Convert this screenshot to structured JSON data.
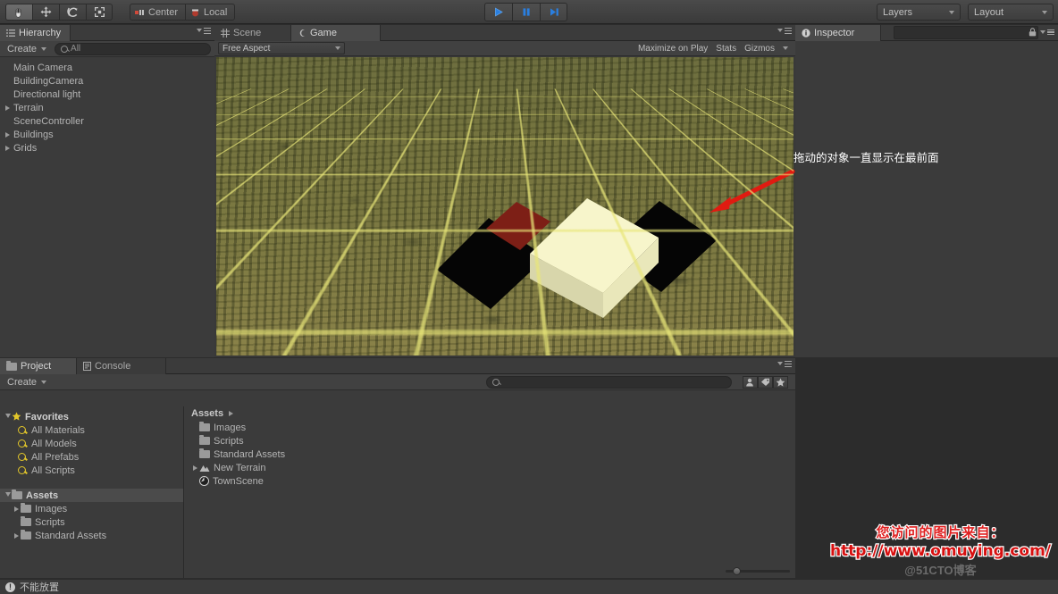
{
  "toolbar": {
    "tools": [
      {
        "name": "hand-tool",
        "icon": "hand-icon",
        "active": true
      },
      {
        "name": "move-tool",
        "icon": "move-icon",
        "active": false
      },
      {
        "name": "rotate-tool",
        "icon": "rotate-icon",
        "active": false
      },
      {
        "name": "scale-tool",
        "icon": "scale-icon",
        "active": false
      }
    ],
    "pivot_label": "Center",
    "rotation_label": "Local",
    "play_buttons": [
      {
        "name": "play-button",
        "icon": "play-icon"
      },
      {
        "name": "pause-button",
        "icon": "pause-icon"
      },
      {
        "name": "step-button",
        "icon": "step-icon"
      }
    ],
    "layers_label": "Layers",
    "layout_label": "Layout"
  },
  "hierarchy": {
    "tab_label": "Hierarchy",
    "create_label": "Create",
    "search_placeholder": "All",
    "search_value": "",
    "items": [
      {
        "label": "Main Camera",
        "expandable": false,
        "indent": 0
      },
      {
        "label": "BuildingCamera",
        "expandable": false,
        "indent": 0
      },
      {
        "label": "Directional light",
        "expandable": false,
        "indent": 0
      },
      {
        "label": "Terrain",
        "expandable": true,
        "indent": 0
      },
      {
        "label": "SceneController",
        "expandable": false,
        "indent": 0
      },
      {
        "label": "Buildings",
        "expandable": true,
        "indent": 0
      },
      {
        "label": "Grids",
        "expandable": true,
        "indent": 0
      }
    ]
  },
  "gameview": {
    "tabs": [
      {
        "label": "Scene",
        "icon": "grid-icon",
        "active": false
      },
      {
        "label": "Game",
        "icon": "gamepad-icon",
        "active": true
      }
    ],
    "aspect_label": "Free Aspect",
    "maximize_label": "Maximize on Play",
    "stats_label": "Stats",
    "gizmos_label": "Gizmos"
  },
  "inspector": {
    "tab_label": "Inspector",
    "search_value": ""
  },
  "project": {
    "tabs": [
      {
        "label": "Project",
        "icon": "folder-icon",
        "active": true
      },
      {
        "label": "Console",
        "icon": "console-icon",
        "active": false
      }
    ],
    "create_label": "Create",
    "search_placeholder": "",
    "search_value": "",
    "filter_icons": [
      "person-filter-icon",
      "tag-filter-icon",
      "favorite-filter-icon"
    ],
    "favorites_label": "Favorites",
    "favorites": [
      {
        "label": "All Materials"
      },
      {
        "label": "All Models"
      },
      {
        "label": "All Prefabs"
      },
      {
        "label": "All Scripts"
      }
    ],
    "assets_label": "Assets",
    "asset_tree": [
      {
        "label": "Images",
        "expandable": true,
        "type": "folder"
      },
      {
        "label": "Scripts",
        "expandable": false,
        "type": "folder"
      },
      {
        "label": "Standard Assets",
        "expandable": true,
        "type": "folder"
      }
    ],
    "breadcrumb": "Assets",
    "contents": [
      {
        "label": "Images",
        "type": "folder",
        "expandable": false
      },
      {
        "label": "Scripts",
        "type": "folder",
        "expandable": false
      },
      {
        "label": "Standard Assets",
        "type": "folder",
        "expandable": false
      },
      {
        "label": "New Terrain",
        "type": "terrain",
        "expandable": true
      },
      {
        "label": "TownScene",
        "type": "scene",
        "expandable": false
      }
    ]
  },
  "statusbar": {
    "message": "不能放置"
  },
  "annotations": {
    "note_text": "拖动的对象一直显示在最前面",
    "arrow_color": "#e01b11",
    "watermark_line1": "您访问的图片来自：",
    "watermark_line2": "http://www.omuying.com/",
    "watermark_line3": "@51CTO博客"
  },
  "scene": {
    "objects": [
      {
        "name": "black-cube-left",
        "color": "#050505"
      },
      {
        "name": "red-cube",
        "color": "#8a2018"
      },
      {
        "name": "cream-box",
        "color": "#f4f2c4"
      },
      {
        "name": "black-cube-right",
        "color": "#050505"
      }
    ],
    "grid_color": "#e8e678",
    "terrain_color": "#7c7942"
  },
  "colors": {
    "accent_blue": "#3b7dd8",
    "panel_bg": "#3b3b3b",
    "toolbar_bg": "#4a4a4a",
    "text": "#b4b4b4",
    "favorite_yellow": "#e3c72a"
  }
}
